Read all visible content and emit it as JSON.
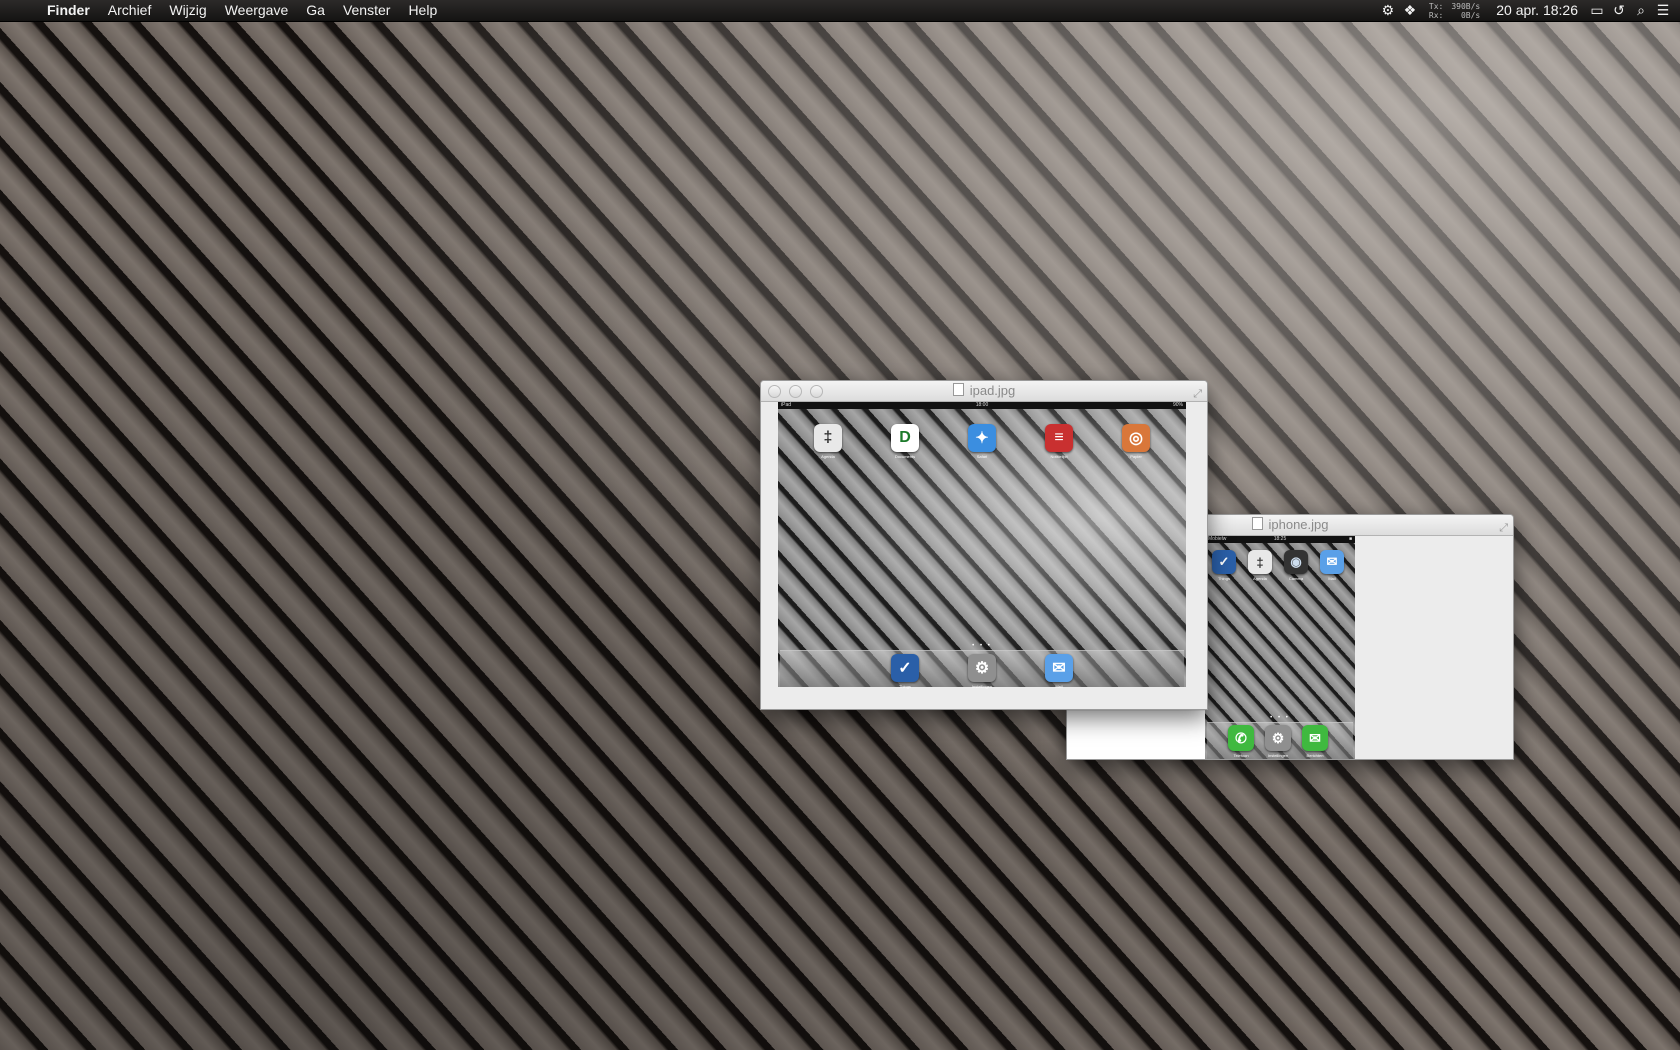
{
  "menubar": {
    "app_name": "Finder",
    "items": [
      "Archief",
      "Wijzig",
      "Weergave",
      "Ga",
      "Venster",
      "Help"
    ],
    "netstat": {
      "tx_label": "Tx:",
      "rx_label": "Rx:",
      "tx_value": "390B/s",
      "rx_value": "0B/s"
    },
    "clock": "20 apr.  18:26",
    "tray_icons": [
      "gear-icon",
      "dropbox-icon",
      "battery-icon",
      "time-machine-icon",
      "spotlight-icon",
      "notification-center-icon"
    ]
  },
  "windows": {
    "ipad": {
      "title": "ipad.jpg",
      "status": {
        "carrier": "iPad",
        "time": "18:00",
        "battery": "90%"
      },
      "apps": [
        {
          "label": "Agenda",
          "color": "#e8e8e8",
          "glyph": "‡"
        },
        {
          "label": "Documents",
          "color": "#ffffff",
          "glyph": "D"
        },
        {
          "label": "Safari",
          "color": "#3b8ee0",
          "glyph": "✦"
        },
        {
          "label": "Notitielijst",
          "color": "#c93030",
          "glyph": "≡"
        },
        {
          "label": "Papier",
          "color": "#d9773a",
          "glyph": "◎"
        }
      ],
      "dock_apps": [
        {
          "label": "Things",
          "color": "#2a5fa8",
          "glyph": "✓"
        },
        {
          "label": "Instellingen",
          "color": "#8f8f8f",
          "glyph": "⚙"
        },
        {
          "label": "Mail",
          "color": "#5aa0e8",
          "glyph": "✉"
        }
      ],
      "page_dots": "• • •"
    },
    "iphone": {
      "title": "iphone.jpg",
      "status": {
        "carrier": "Mobielw",
        "time": "18:25",
        "battery": "■"
      },
      "apps": [
        {
          "label": "Things",
          "color": "#2a5fa8",
          "glyph": "✓"
        },
        {
          "label": "Agenda",
          "color": "#e8e8e8",
          "glyph": "‡"
        },
        {
          "label": "Camera",
          "color": "#333333",
          "glyph": "◉"
        },
        {
          "label": "Mail",
          "color": "#5aa0e8",
          "glyph": "✉"
        }
      ],
      "dock_apps": [
        {
          "label": "Telefoon",
          "color": "#3fb93f",
          "glyph": "✆"
        },
        {
          "label": "Instellingen",
          "color": "#8f8f8f",
          "glyph": "⚙"
        },
        {
          "label": "Berichten",
          "color": "#3fb93f",
          "glyph": "✉"
        }
      ],
      "page_dots": "• • •"
    }
  }
}
